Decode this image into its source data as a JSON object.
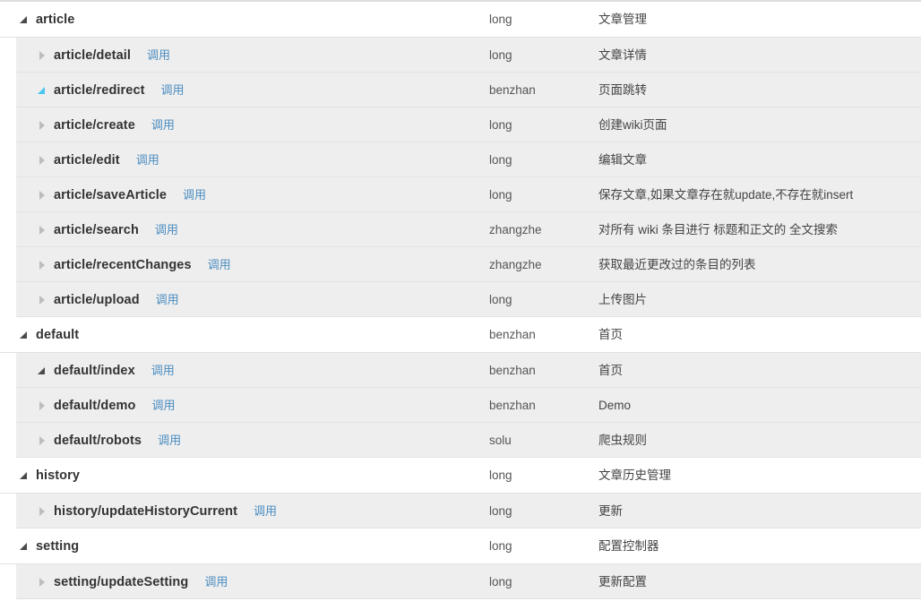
{
  "table": {
    "invoke_label": "调用",
    "colors": {
      "link": "#4a8cc0",
      "child_row_bg": "#eeeeee",
      "root_row_bg": "#ffffff",
      "border": "#e2e2e2",
      "twisty_collapsed": "#bdbdbd",
      "twisty_expanded": "#4a4a4a",
      "twisty_active": "#49c7f0"
    },
    "rows": [
      {
        "level": 0,
        "name": "article",
        "state": "expanded",
        "active": false,
        "has_invoke": false,
        "author": "long",
        "desc": "文章管理"
      },
      {
        "level": 1,
        "name": "article/detail",
        "state": "collapsed",
        "active": false,
        "has_invoke": true,
        "author": "long",
        "desc": "文章详情"
      },
      {
        "level": 1,
        "name": "article/redirect",
        "state": "expanded",
        "active": true,
        "has_invoke": true,
        "author": "benzhan",
        "desc": "页面跳转"
      },
      {
        "level": 1,
        "name": "article/create",
        "state": "collapsed",
        "active": false,
        "has_invoke": true,
        "author": "long",
        "desc": "创建wiki页面"
      },
      {
        "level": 1,
        "name": "article/edit",
        "state": "collapsed",
        "active": false,
        "has_invoke": true,
        "author": "long",
        "desc": "编辑文章"
      },
      {
        "level": 1,
        "name": "article/saveArticle",
        "state": "collapsed",
        "active": false,
        "has_invoke": true,
        "author": "long",
        "desc": "保存文章,如果文章存在就update,不存在就insert"
      },
      {
        "level": 1,
        "name": "article/search",
        "state": "collapsed",
        "active": false,
        "has_invoke": true,
        "author": "zhangzhe",
        "desc": "对所有 wiki 条目进行 标题和正文的 全文搜索"
      },
      {
        "level": 1,
        "name": "article/recentChanges",
        "state": "collapsed",
        "active": false,
        "has_invoke": true,
        "author": "zhangzhe",
        "desc": "获取最近更改过的条目的列表"
      },
      {
        "level": 1,
        "name": "article/upload",
        "state": "collapsed",
        "active": false,
        "has_invoke": true,
        "author": "long",
        "desc": "上传图片"
      },
      {
        "level": 0,
        "name": "default",
        "state": "expanded",
        "active": false,
        "has_invoke": false,
        "author": "benzhan",
        "desc": "首页"
      },
      {
        "level": 1,
        "name": "default/index",
        "state": "expanded",
        "active": false,
        "has_invoke": true,
        "author": "benzhan",
        "desc": "首页"
      },
      {
        "level": 1,
        "name": "default/demo",
        "state": "collapsed",
        "active": false,
        "has_invoke": true,
        "author": "benzhan",
        "desc": "Demo"
      },
      {
        "level": 1,
        "name": "default/robots",
        "state": "collapsed",
        "active": false,
        "has_invoke": true,
        "author": "solu",
        "desc": "爬虫规则"
      },
      {
        "level": 0,
        "name": "history",
        "state": "expanded",
        "active": false,
        "has_invoke": false,
        "author": "long",
        "desc": "文章历史管理"
      },
      {
        "level": 1,
        "name": "history/updateHistoryCurrent",
        "state": "collapsed",
        "active": false,
        "has_invoke": true,
        "author": "long",
        "desc": "更新"
      },
      {
        "level": 0,
        "name": "setting",
        "state": "expanded",
        "active": false,
        "has_invoke": false,
        "author": "long",
        "desc": "配置控制器"
      },
      {
        "level": 1,
        "name": "setting/updateSetting",
        "state": "collapsed",
        "active": false,
        "has_invoke": true,
        "author": "long",
        "desc": "更新配置"
      }
    ]
  }
}
